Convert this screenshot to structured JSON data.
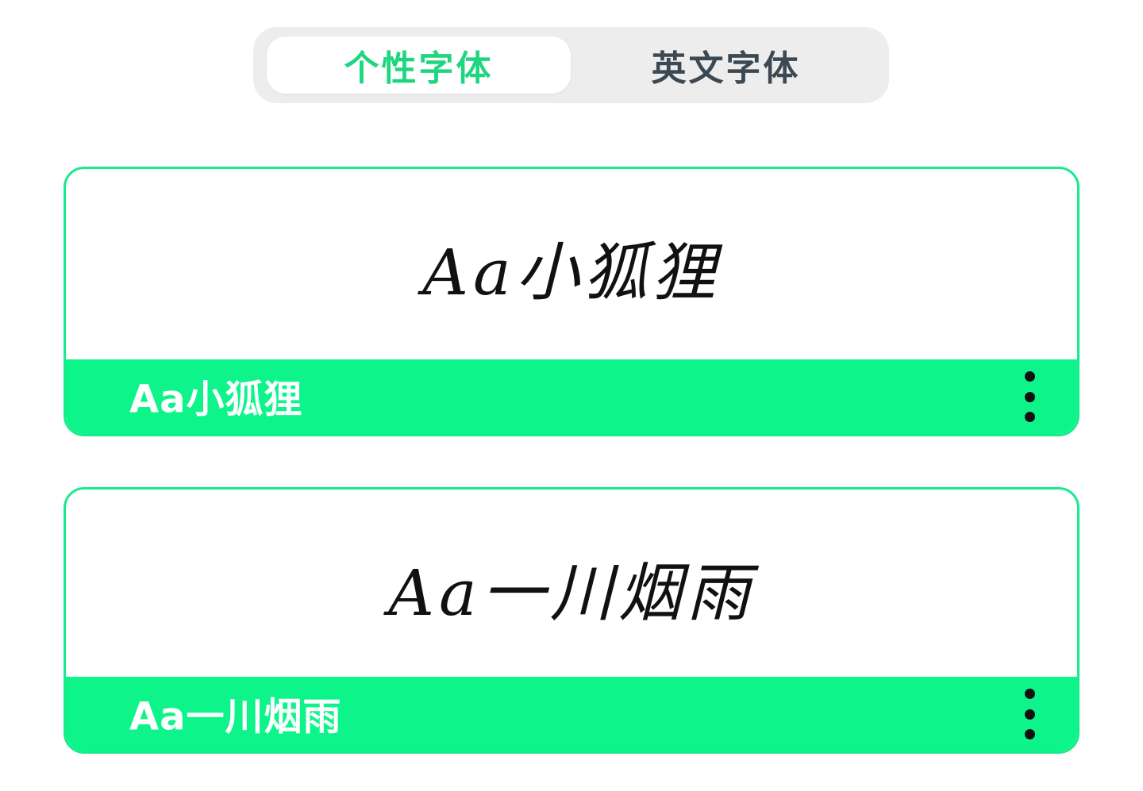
{
  "colors": {
    "accent": "#19ea8c",
    "accent_fill": "#0df58a",
    "active_tab_text": "#1fd67f",
    "inactive_tab_text": "#3c4852",
    "tab_track": "#ededed",
    "dots": "#111111"
  },
  "tabs": [
    {
      "label": "个性字体",
      "active": true
    },
    {
      "label": "英文字体",
      "active": false
    }
  ],
  "fonts": [
    {
      "preview": "Aa小狐狸",
      "name": "Aa小狐狸",
      "menu_icon": "more-vertical-icon"
    },
    {
      "preview": "Aa一川烟雨",
      "name": "Aa一川烟雨",
      "menu_icon": "more-vertical-icon"
    }
  ]
}
